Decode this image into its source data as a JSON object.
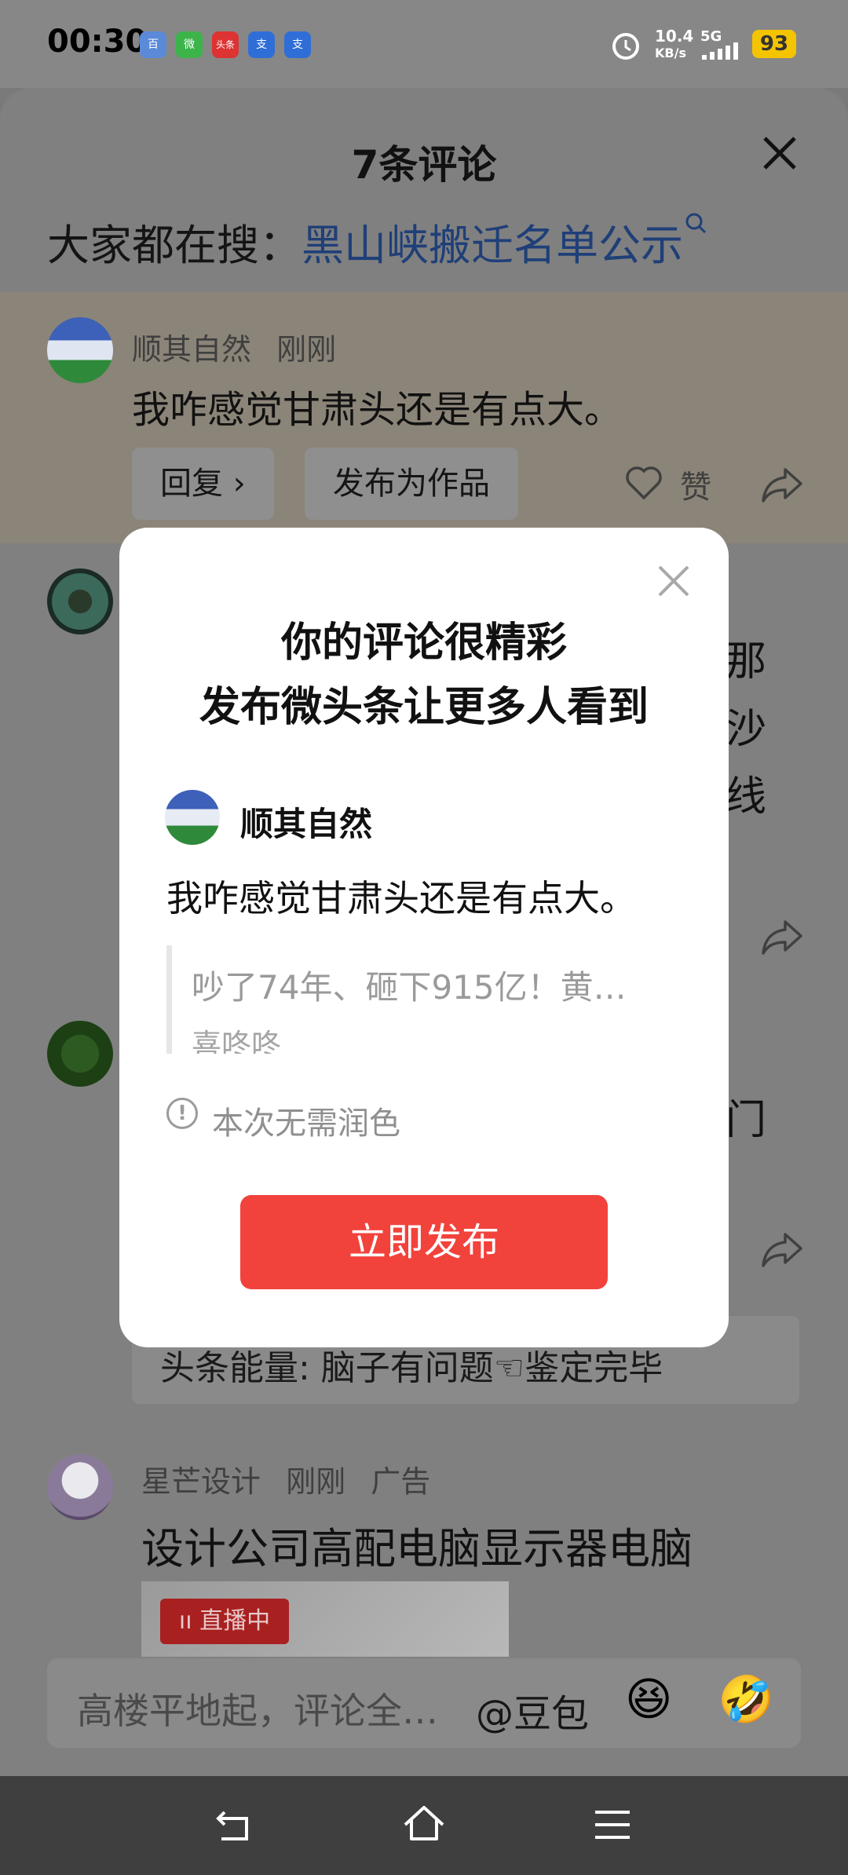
{
  "status_bar": {
    "time": "00:30",
    "apps": [
      "百",
      "微",
      "头条",
      "支",
      "支"
    ],
    "net_speed_top": "10.4",
    "net_speed_unit": "KB/s",
    "signal": "5G",
    "battery": "93"
  },
  "comments_sheet": {
    "title": "7条评论",
    "search_label": "大家都在搜：",
    "search_link": "黑山峡搬迁名单公示",
    "highlighted_comment": {
      "user": "顺其自然",
      "time": "刚刚",
      "text": "我咋感觉甘肃头还是有点大。",
      "reply_label": "回复 ›",
      "publish_label": "发布为作品",
      "like_label": "赞"
    },
    "partial_comment_chars": [
      "那",
      "沙",
      "线"
    ],
    "partial_char_3": "门",
    "energy_text": "头条能量: 脑子有问题☜鉴定完毕",
    "ad_comment": {
      "user": "星芒设计",
      "time": "刚刚",
      "tag": "广告",
      "text": "设计公司高配电脑显示器电脑",
      "live_tag": "ıı 直播中"
    },
    "input": {
      "placeholder": "高楼平地起，评论全…",
      "doubao": "@豆包",
      "emoji_1": "😆",
      "emoji_2": "🤣"
    }
  },
  "modal": {
    "title_line1": "你的评论很精彩",
    "title_line2": "发布微头条让更多人看到",
    "user": "顺其自然",
    "comment": "我咋感觉甘肃头还是有点大。",
    "quote_title": "吵了74年、砸下915亿！黄…",
    "quote_author": "喜咚咚",
    "info_icon": "!",
    "info_text": "本次无需润色",
    "publish_button": "立即发布"
  },
  "colors": {
    "link": "#1f3f78",
    "publish_button": "#f2423c",
    "battery": "#f5c400"
  }
}
